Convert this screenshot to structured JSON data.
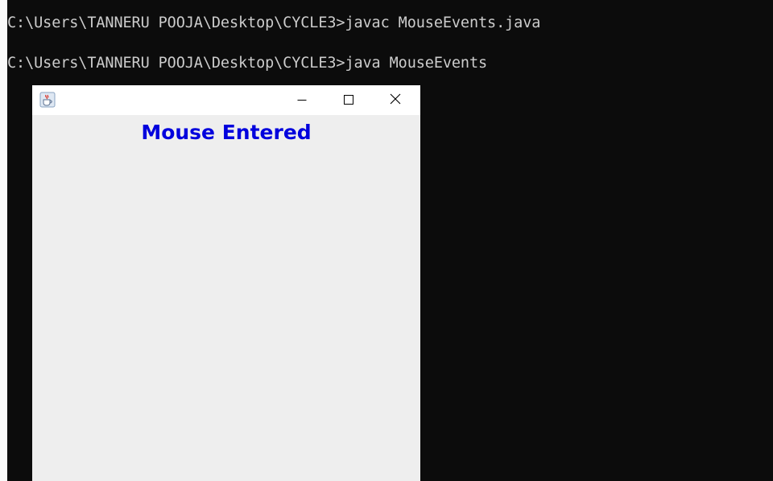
{
  "console": {
    "lines": [
      "C:\\Users\\TANNERU POOJA\\Desktop\\CYCLE3>javac MouseEvents.java",
      "C:\\Users\\TANNERU POOJA\\Desktop\\CYCLE3>java MouseEvents"
    ]
  },
  "window": {
    "icon": "java-cup-icon",
    "controls": [
      "minimize-icon",
      "maximize-icon",
      "close-icon"
    ]
  },
  "content": {
    "label": "Mouse Entered",
    "label_color": "#0000dd"
  },
  "colors": {
    "console_bg": "#0c0c0c",
    "console_text": "#cccccc",
    "window_bg": "#eeeeee",
    "titlebar_bg": "#ffffff"
  }
}
